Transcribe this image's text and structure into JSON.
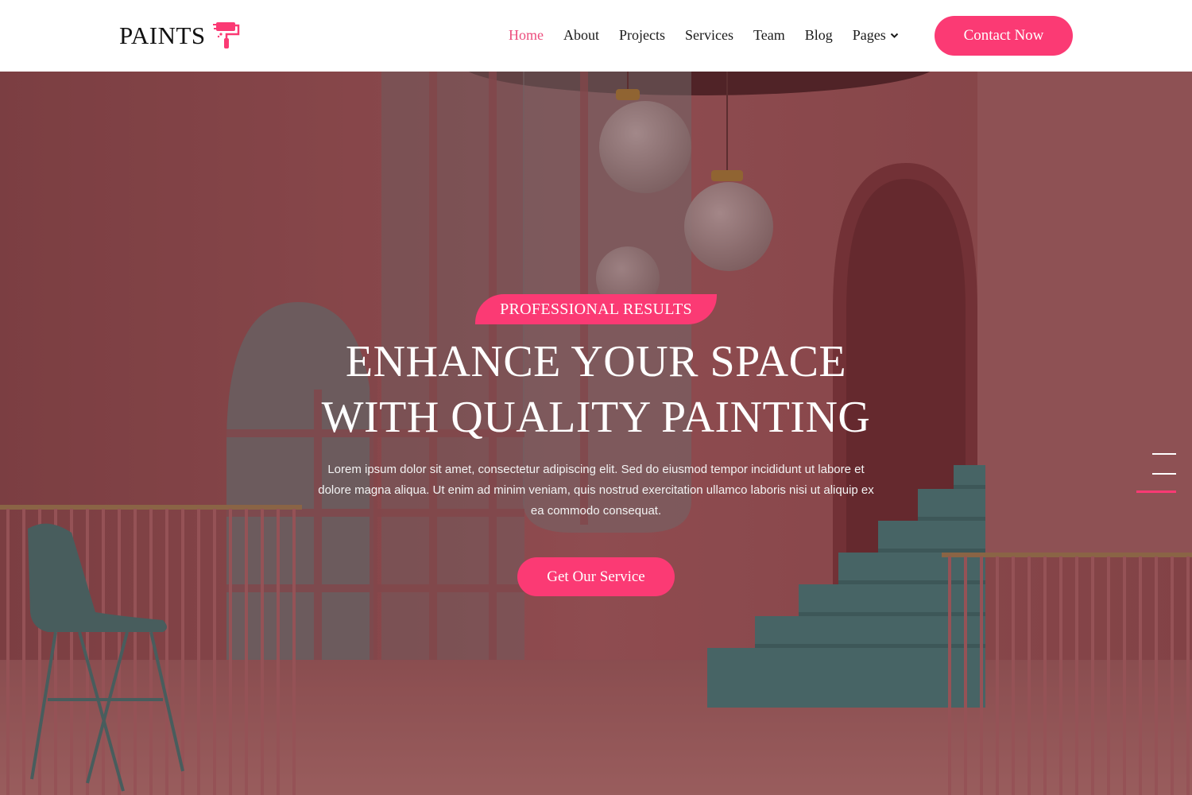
{
  "brand": {
    "name": "PAINTS",
    "accent": "#fb3a74",
    "icon": "paint-roller-icon"
  },
  "nav": {
    "items": [
      {
        "label": "Home",
        "active": true
      },
      {
        "label": "About"
      },
      {
        "label": "Projects"
      },
      {
        "label": "Services"
      },
      {
        "label": "Team"
      },
      {
        "label": "Blog"
      },
      {
        "label": "Pages",
        "dropdown": true
      }
    ],
    "cta": "Contact Now"
  },
  "hero": {
    "badge": "PROFESSIONAL RESULTS",
    "title_line1": "ENHANCE YOUR SPACE",
    "title_line2": "WITH QUALITY PAINTING",
    "description": "Lorem ipsum dolor sit amet, consectetur adipiscing elit. Sed do eiusmod tempor incididunt ut labore et dolore magna aliqua. Ut enim ad minim veniam, quis nostrud exercitation ullamco laboris nisi ut aliquip ex ea commodo consequat.",
    "button": "Get Our Service"
  }
}
